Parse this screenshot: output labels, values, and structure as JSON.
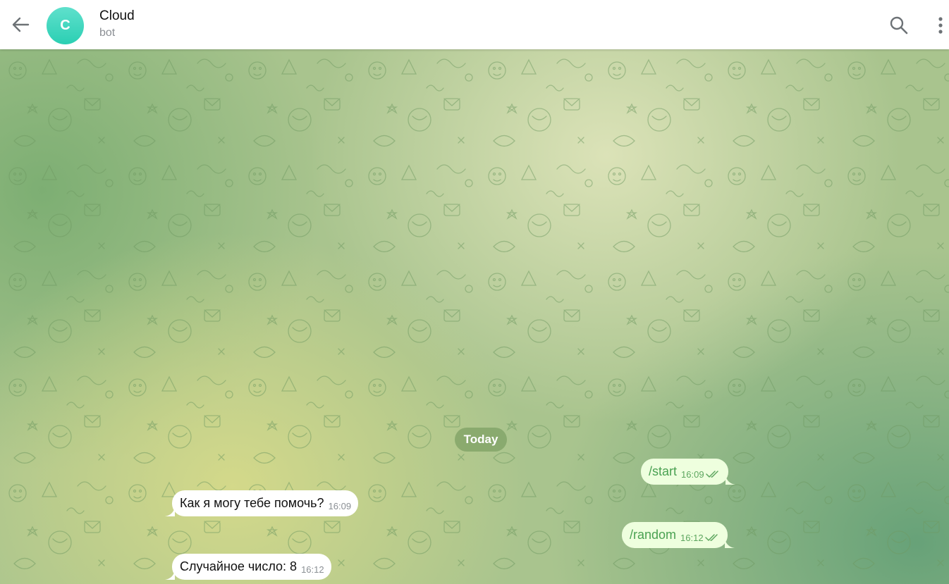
{
  "header": {
    "title": "Cloud",
    "subtitle": "bot",
    "avatar_letter": "C"
  },
  "chat": {
    "date_label": "Today",
    "messages": [
      {
        "direction": "outgoing",
        "text": "/start",
        "time": "16:09",
        "status": "read"
      },
      {
        "direction": "incoming",
        "text": "Как я могу тебе помочь?",
        "time": "16:09"
      },
      {
        "direction": "outgoing",
        "text": "/random",
        "time": "16:12",
        "status": "read"
      },
      {
        "direction": "incoming",
        "text": "Случайное число: 8",
        "time": "16:12"
      }
    ]
  },
  "colors": {
    "avatar": "#2bcfb3",
    "outgoing_bubble": "#eeffde",
    "outgoing_text": "#4aa152",
    "incoming_bubble": "#ffffff"
  },
  "icons": {
    "back": "arrow-left-icon",
    "search": "search-icon",
    "menu": "more-vertical-icon",
    "read_status": "double-check-icon"
  }
}
